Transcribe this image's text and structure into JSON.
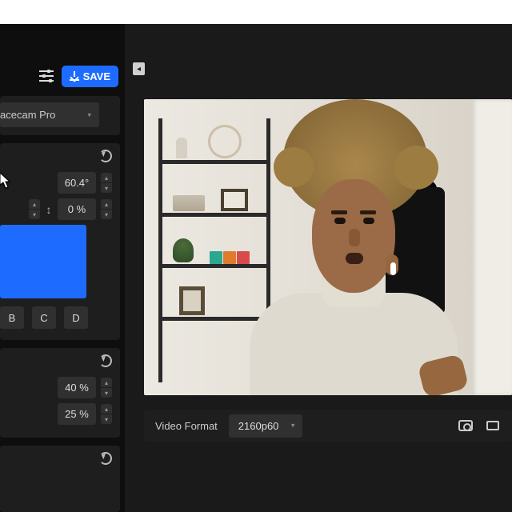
{
  "toolbar": {
    "save_label": "SAVE"
  },
  "camera_select": {
    "value": "acecam Pro"
  },
  "section1": {
    "angle": "60.4°",
    "percent": "0 %"
  },
  "presets": [
    "B",
    "C",
    "D"
  ],
  "section2": {
    "value_a": "40 %",
    "value_b": "25 %"
  },
  "bottom": {
    "format_label": "Video Format",
    "format_value": "2160p60"
  },
  "colors": {
    "swatch": "#1e6cff"
  }
}
